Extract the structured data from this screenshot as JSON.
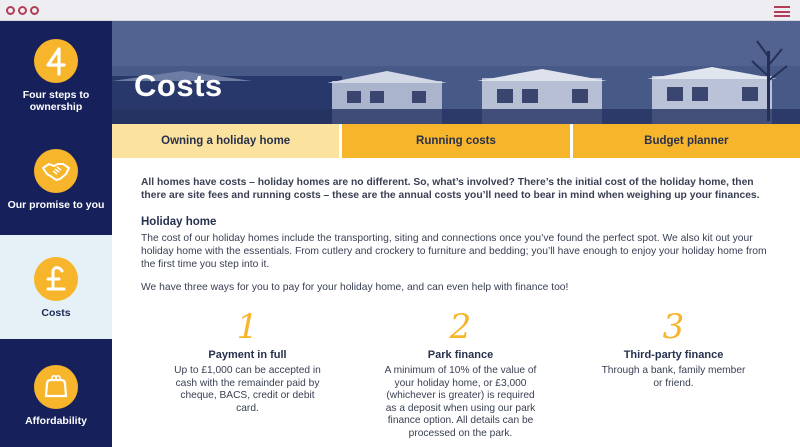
{
  "sidebar": {
    "items": [
      {
        "label": "Four steps to ownership",
        "icon": "number-four-icon",
        "active": false
      },
      {
        "label": "Our promise to you",
        "icon": "handshake-icon",
        "active": false
      },
      {
        "label": "Costs",
        "icon": "pound-sign-icon",
        "active": true
      },
      {
        "label": "Affordability",
        "icon": "purse-icon",
        "active": false
      }
    ]
  },
  "hero": {
    "title": "Costs"
  },
  "tabs": [
    {
      "label": "Owning a holiday home",
      "active": true
    },
    {
      "label": "Running costs",
      "active": false
    },
    {
      "label": "Budget planner",
      "active": false
    }
  ],
  "content": {
    "intro": "All homes have costs – holiday homes are no different. So, what’s involved? There’s the initial cost of the holiday home, then there are site fees and running costs – these are the annual costs you’ll need to bear in mind when weighing up your finances.",
    "heading": "Holiday home",
    "para1": "The cost of our holiday homes include the transporting, siting and connections once you’ve found the perfect spot. We also kit out your holiday home with the essentials. From cutlery and crockery to furniture and bedding; you’ll have enough to enjoy your holiday home from the first time you step into it.",
    "para2": "We have three ways for you to pay for your holiday home, and can even help with finance too!"
  },
  "payment_options": [
    {
      "number": "1",
      "title": "Payment in full",
      "text": "Up to £1,000 can be accepted in cash with the remainder paid by cheque, BACS, credit or debit card."
    },
    {
      "number": "2",
      "title": "Park finance",
      "text": "A minimum of 10% of the value of your holiday home, or £3,000 (whichever is greater) is required as a deposit when using our park finance option. All details can be processed on the park."
    },
    {
      "number": "3",
      "title": "Third-party finance",
      "text": "Through a bank, family member or friend."
    }
  ],
  "colors": {
    "navy": "#16205a",
    "accent": "#f7b52b",
    "accent_light": "#fbe29e",
    "browser_red": "#b23d57"
  }
}
